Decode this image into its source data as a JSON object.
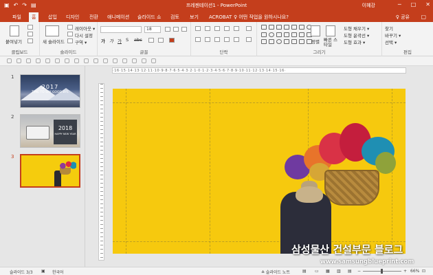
{
  "window": {
    "title": "프레젠테이션1 - PowerPoint",
    "user": "이혜강",
    "controls": [
      "─",
      "□",
      "✕"
    ],
    "qat_icons": [
      "save-icon",
      "undo-icon",
      "redo-icon",
      "present-icon"
    ]
  },
  "tabs": [
    {
      "label": "파일"
    },
    {
      "label": "홈"
    },
    {
      "label": "삽입"
    },
    {
      "label": "디자인"
    },
    {
      "label": "전환"
    },
    {
      "label": "애니메이션"
    },
    {
      "label": "슬라이드 쇼"
    },
    {
      "label": "검토"
    },
    {
      "label": "보기"
    },
    {
      "label": "ACROBAT"
    }
  ],
  "tell_me": "♀ 어떤 작업을 원하시나요?",
  "share": "♀ 공유",
  "ribbon": {
    "clipboard": {
      "paste": "붙여넣기",
      "label": "클립보드"
    },
    "slides": {
      "new_slide": "새 슬라이드",
      "layout": "레이아웃 ▾",
      "reset": "다시 설정",
      "section": "구역 ▾",
      "label": "슬라이드"
    },
    "font": {
      "label": "글꼴",
      "size": "18"
    },
    "paragraph": {
      "label": "단락"
    },
    "drawing": {
      "arrange": "정렬",
      "quick_styles": "빠른 스타일",
      "fill": "도형 채우기 ▾",
      "outline": "도형 윤곽선 ▾",
      "effects": "도형 효과 ▾",
      "label": "그리기"
    },
    "editing": {
      "find": "찾기",
      "replace": "바꾸기 ▾",
      "select": "선택 ▾",
      "label": "편집"
    }
  },
  "thumbnails": [
    {
      "number": "1",
      "title": "2017",
      "subtitle": "TIME TO SAY GOOD BYE"
    },
    {
      "number": "2",
      "year": "2018",
      "line": "HAPPY NEW YEAR"
    },
    {
      "number": "3"
    }
  ],
  "ruler": "·16·15·14·13·12·11·10·9·8·7·6·5·4·3·2·1·0·1·2·3·4·5·6·7·8·9·10·11·12·13·14·15·16·",
  "watermark": {
    "korean": "삼성물산 건설부문 블로그",
    "url": "www.samsungblueprint.com"
  },
  "status": {
    "slide": "슬라이드 3/3",
    "language": "한국어",
    "notes": "≙ 슬라이드 노트",
    "zoom": "66%"
  },
  "colors": {
    "accent": "#c43e1c",
    "slide_bg": "#f6c90e"
  }
}
